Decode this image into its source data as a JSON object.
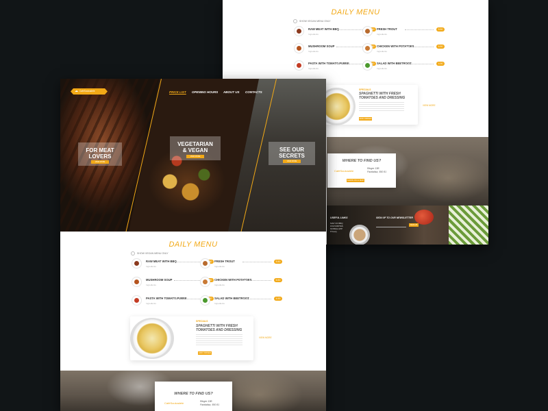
{
  "brand": {
    "logo": "CaféSoulcadele"
  },
  "nav": {
    "items": [
      "PRICE LIST",
      "OPENING HOURS",
      "ABOUT US",
      "CONTACTS"
    ]
  },
  "hero": {
    "panels": [
      {
        "title_line1": "FOR MEAT",
        "title_line2": "LOVERS",
        "button": "VIEW MORE"
      },
      {
        "title_line1": "VEGETARIAN",
        "title_line2": "& VEGAN",
        "button": "VIEW MORE"
      },
      {
        "title_line1": "SEE OUR",
        "title_line2": "SECRETS",
        "button": "VIEW MORE"
      }
    ]
  },
  "daily_menu": {
    "title": "DAILY MENU",
    "toggle": "SHOW VEGAN MENU ONLY",
    "items": [
      {
        "name": "RAW MEAT WITH BBQ",
        "sub": "Ingredients",
        "price": "7.50",
        "color": "#8b3a1e"
      },
      {
        "name": "FRESH TROUT",
        "sub": "Ingredients",
        "price": "5.50",
        "color": "#b86b2e"
      },
      {
        "name": "MUSHROOM SOUP",
        "sub": "Ingredients",
        "price": "4.80",
        "color": "#b5541f"
      },
      {
        "name": "CHICKEN WITH POTATOES",
        "sub": "Ingredients",
        "price": "6.50",
        "color": "#c97a35"
      },
      {
        "name": "PASTA WITH TOMATO PUREE",
        "sub": "Ingredients",
        "price": "5.20",
        "color": "#c43c24"
      },
      {
        "name": "SALAD WITH BEETROOT",
        "sub": "Ingredients",
        "price": "4.90",
        "color": "#4c9a2e"
      }
    ]
  },
  "featured": {
    "category": "SPECIALS",
    "title_line1": "SPAGHETTI WITH FRESH",
    "title_line2": "TOMATOES AND DRESSING",
    "button": "ADD ORDER",
    "view_more": "VIEW MORE"
  },
  "find_us": {
    "title": "WHERE TO FIND US?",
    "logo": "CaféSoulcadele",
    "address_line1": "Ringer 13B",
    "address_line2": "Pazdaitsa, 550 81",
    "button": "SHOW ON A MAP"
  },
  "footer": {
    "useful_links": "USEFUL LINKS",
    "links": [
      "MAP OF BBQ",
      "FAVOURITES",
      "MOBILE APP",
      "Privacy"
    ],
    "newsletter_title": "SIGN UP TO OUR NEWSLETTER",
    "newsletter_button": "SIGN UP"
  }
}
